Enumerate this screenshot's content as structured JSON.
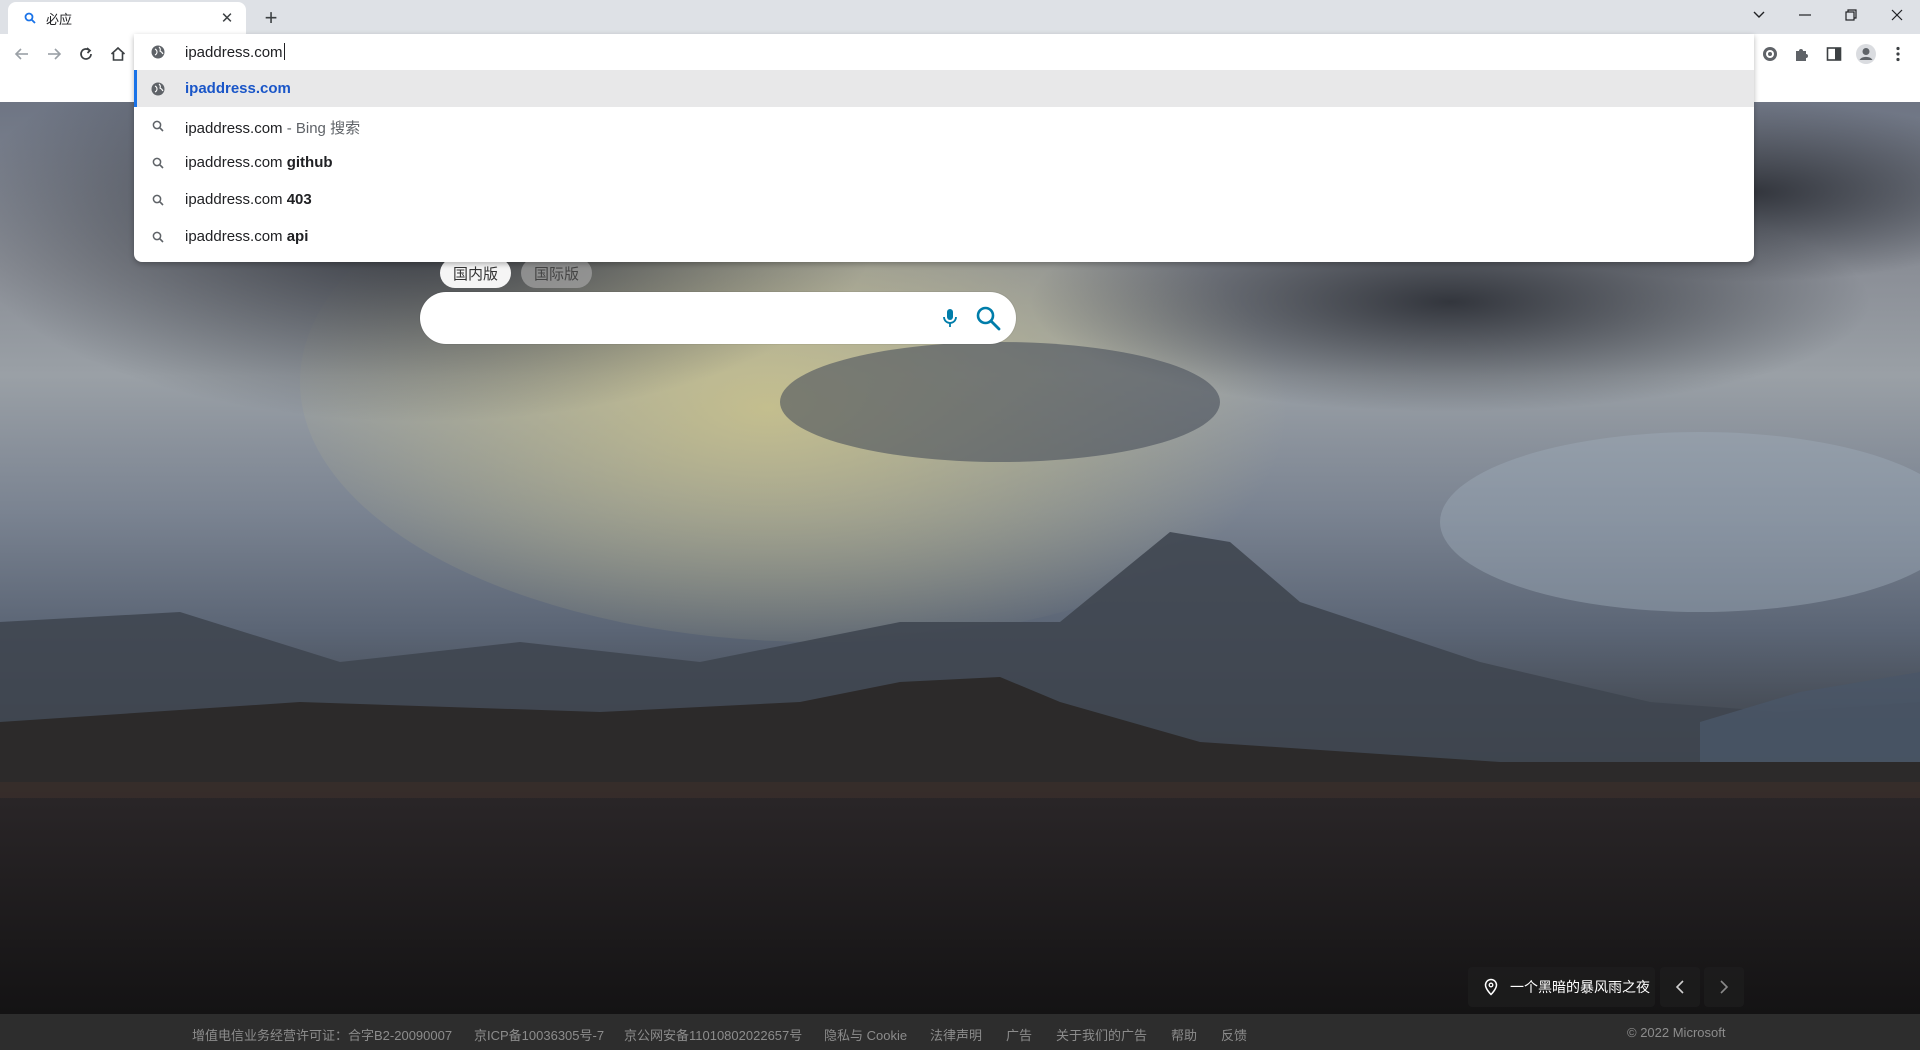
{
  "browser": {
    "tab": {
      "title": "必应",
      "close": "✕"
    },
    "new_tab": "+",
    "window_controls": {
      "minimize": "—",
      "maximize": "❐",
      "close": "✕"
    }
  },
  "omnibox": {
    "text": "ipaddress.com",
    "suggestions": [
      {
        "main": "ipaddress.com",
        "type": "url"
      },
      {
        "main": "ipaddress.com",
        "desc": " - Bing 搜索",
        "type": "search"
      },
      {
        "main": "ipaddress.com ",
        "bold": "github",
        "type": "search"
      },
      {
        "main": "ipaddress.com ",
        "bold": "403",
        "type": "search"
      },
      {
        "main": "ipaddress.com ",
        "bold": "api",
        "type": "search"
      }
    ]
  },
  "bing": {
    "tabs": {
      "domestic": "国内版",
      "international": "国际版"
    },
    "search_placeholder": "",
    "image_title": "一个黑暗的暴风雨之夜"
  },
  "footer": {
    "license": "增值电信业务经营许可证：合字B2-20090007",
    "icp": "京ICP备10036305号-7",
    "police": "京公网安备11010802022657号",
    "privacy": "隐私与 Cookie",
    "legal": "法律声明",
    "ads": "广告",
    "about_ads": "关于我们的广告",
    "help": "帮助",
    "feedback": "反馈",
    "copyright": "© 2022 Microsoft"
  },
  "colors": {
    "accent": "#1a73e8",
    "bing_teal": "#007daa",
    "footer_bg": "#2d2d2d"
  }
}
